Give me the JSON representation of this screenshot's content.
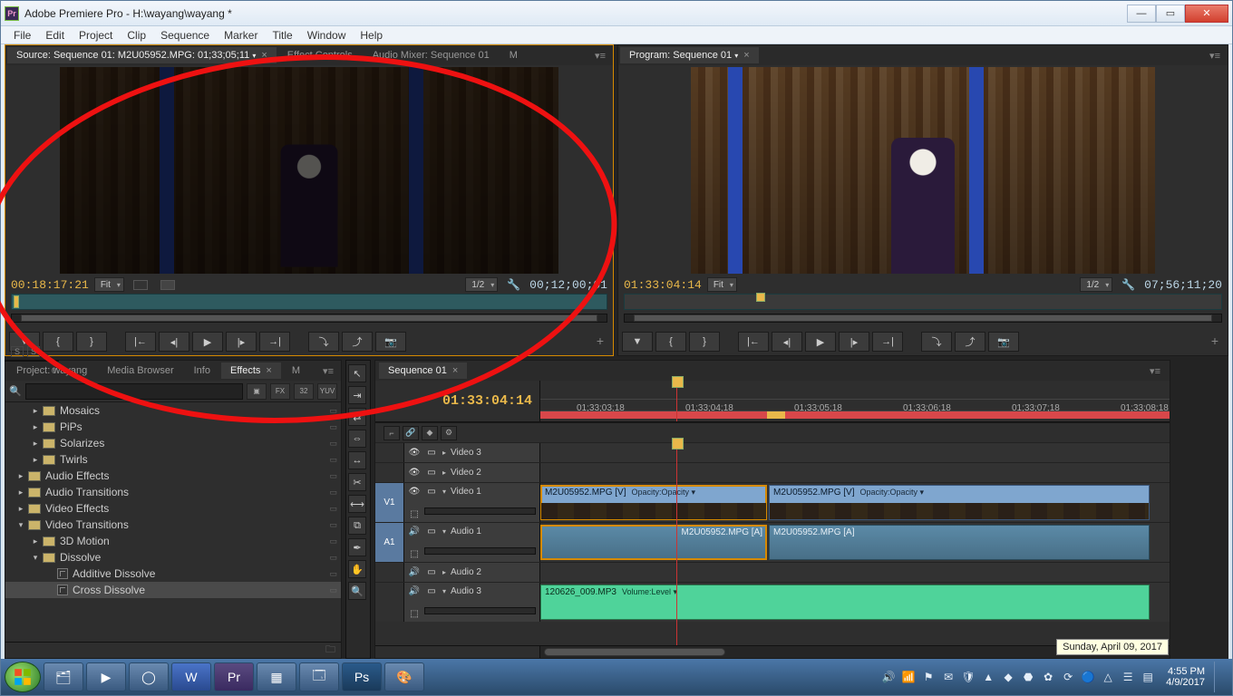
{
  "window": {
    "title": "Adobe Premiere Pro - H:\\wayang\\wayang *"
  },
  "menu": [
    "File",
    "Edit",
    "Project",
    "Clip",
    "Sequence",
    "Marker",
    "Title",
    "Window",
    "Help"
  ],
  "source": {
    "tab": "Source: Sequence 01: M2U05952.MPG: 01;33;05;11",
    "tab2": "Effect Controls",
    "tab3": "Audio Mixer: Sequence 01",
    "tab4": "M",
    "tc_in": "00:18:17:21",
    "tc_out": "00;12;00;01",
    "zoom": "Fit",
    "res": "1/2"
  },
  "program": {
    "tab": "Program: Sequence 01",
    "tc_in": "01:33:04:14",
    "tc_out": "07;56;11;20",
    "zoom": "Fit",
    "res": "1/2"
  },
  "effects": {
    "tabs": [
      "Project: wayang",
      "Media Browser",
      "Info",
      "Effects",
      "M"
    ],
    "active": 3,
    "toggles": [
      "FX",
      "32",
      "YUV"
    ],
    "tree": [
      {
        "lev": 1,
        "exp": "▸",
        "type": "folder",
        "label": "Mosaics"
      },
      {
        "lev": 1,
        "exp": "▸",
        "type": "folder",
        "label": "PiPs"
      },
      {
        "lev": 1,
        "exp": "▸",
        "type": "folder",
        "label": "Solarizes"
      },
      {
        "lev": 1,
        "exp": "▸",
        "type": "folder",
        "label": "Twirls"
      },
      {
        "lev": 0,
        "exp": "▸",
        "type": "folder",
        "label": "Audio Effects"
      },
      {
        "lev": 0,
        "exp": "▸",
        "type": "folder",
        "label": "Audio Transitions"
      },
      {
        "lev": 0,
        "exp": "▸",
        "type": "folder",
        "label": "Video Effects"
      },
      {
        "lev": 0,
        "exp": "▾",
        "type": "folder",
        "label": "Video Transitions"
      },
      {
        "lev": 1,
        "exp": "▸",
        "type": "folder",
        "label": "3D Motion"
      },
      {
        "lev": 1,
        "exp": "▾",
        "type": "folder",
        "label": "Dissolve"
      },
      {
        "lev": 2,
        "exp": "",
        "type": "fx",
        "label": "Additive Dissolve"
      },
      {
        "lev": 2,
        "exp": "",
        "type": "fx",
        "label": "Cross Dissolve",
        "sel": true
      }
    ]
  },
  "timeline": {
    "tab": "Sequence 01",
    "current": "01:33:04:14",
    "ticks": [
      "01;33;03;18",
      "01;33;04;18",
      "01;33;05;18",
      "01;33;06;18",
      "01;33;07;18",
      "01;33;08;18"
    ],
    "tracks": {
      "v3": "Video 3",
      "v2": "Video 2",
      "v1": "Video 1",
      "a1": "Audio 1",
      "a2": "Audio 2",
      "a3": "Audio 3",
      "srcV": "V1",
      "srcA": "A1"
    },
    "clips": {
      "v1a": "M2U05952.MPG [V]",
      "v1a_meta": "Opacity:Opacity ▾",
      "v1b": "M2U05952.MPG [V]",
      "v1b_meta": "Opacity:Opacity ▾",
      "a1a": "M2U05952.MPG [A]",
      "a1b": "M2U05952.MPG [A]",
      "a3": "120626_009.MP3",
      "a3_meta": "Volume:Level ▾"
    }
  },
  "taskbar": {
    "tooltip": "Sunday, April 09, 2017",
    "time": "4:55 PM",
    "date": "4/9/2017"
  }
}
